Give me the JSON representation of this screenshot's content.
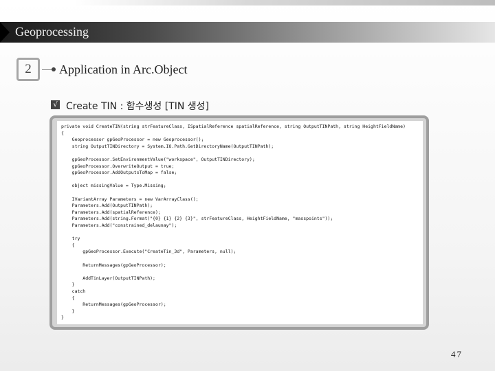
{
  "header": {
    "title": "Geoprocessing"
  },
  "section": {
    "number": "2",
    "title": "Application in Arc.Object"
  },
  "item": {
    "check": "√",
    "label": "Create TIN : 함수생성 [TIN 생성]"
  },
  "code": {
    "lines": [
      "private void CreateTIN(string strFeatureClass, ISpatialReference spatialReference, string OutputTINPath, string HeightFieldName)",
      "{",
      "    Geoprocessor gpGeoProcessor = new Geoprocessor();",
      "    string OutputTINDirectory = System.IO.Path.GetDirectoryName(OutputTINPath);",
      "",
      "    gpGeoProcessor.SetEnvironmentValue(\"workspace\", OutputTINDirectory);",
      "    gpGeoProcessor.OverwriteOutput = true;",
      "    gpGeoProcessor.AddOutputsToMap = false;",
      "",
      "    object missingValue = Type.Missing;",
      "",
      "    IVariantArray Parameters = new VarArrayClass();",
      "    Parameters.Add(OutputTINPath);",
      "    Parameters.Add(spatialReference);",
      "    Parameters.Add(string.Format(\"{0} {1} {2} {3}\", strFeatureClass, HeightFieldName, \"masspoints\"));",
      "    Parameters.Add(\"constrained_delaunay\");",
      "",
      "    try",
      "    {",
      "        gpGeoProcessor.Execute(\"CreateTin_3d\", Parameters, null);",
      "",
      "        ReturnMessages(gpGeoProcessor);",
      "",
      "        AddTinLayer(OutputTINPath);",
      "    }",
      "    catch",
      "    {",
      "        ReturnMessages(gpGeoProcessor);",
      "    }",
      "}"
    ]
  },
  "footer": {
    "page": "47"
  }
}
